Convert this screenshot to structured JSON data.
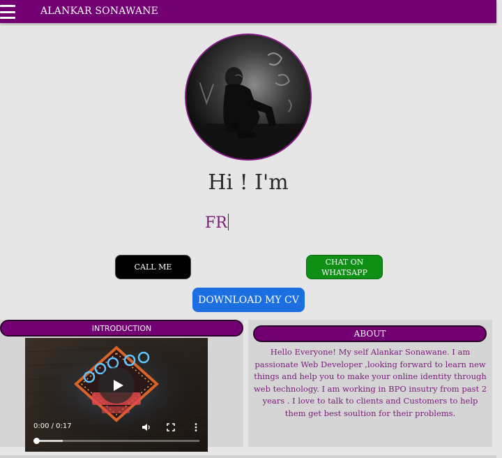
{
  "header": {
    "brand": "ALANKAR SONAWANE",
    "menu_icon": "hamburger-menu-icon",
    "bar_color": "#730073"
  },
  "profile": {
    "greeting": "Hi ! I'm",
    "typed_text": "FR"
  },
  "buttons": {
    "call": "CALL ME",
    "whatsapp_line1": "CHAT ON",
    "whatsapp_line2": "WHATSAPP",
    "download_cv": "DOWNLOAD MY CV"
  },
  "colors": {
    "call_bg": "#000000",
    "whatsapp_bg": "#0f8f16",
    "cv_bg": "#1b6fe0",
    "accent_text": "#7a1b7a"
  },
  "intro": {
    "title": "INTRODUCTION",
    "video": {
      "time": "0:00 / 0:17",
      "progress": 0.0
    }
  },
  "about": {
    "title": "ABOUT",
    "text": "Hello Everyone! My self Alankar Sonawane. I am passionate Web Developer ,looking forward to learn new things and help you to make your online identity through web technology. I am working in BPO insutry from past 2 years . I love to talk to clients and Customers to help them get best soultion for their problems."
  }
}
